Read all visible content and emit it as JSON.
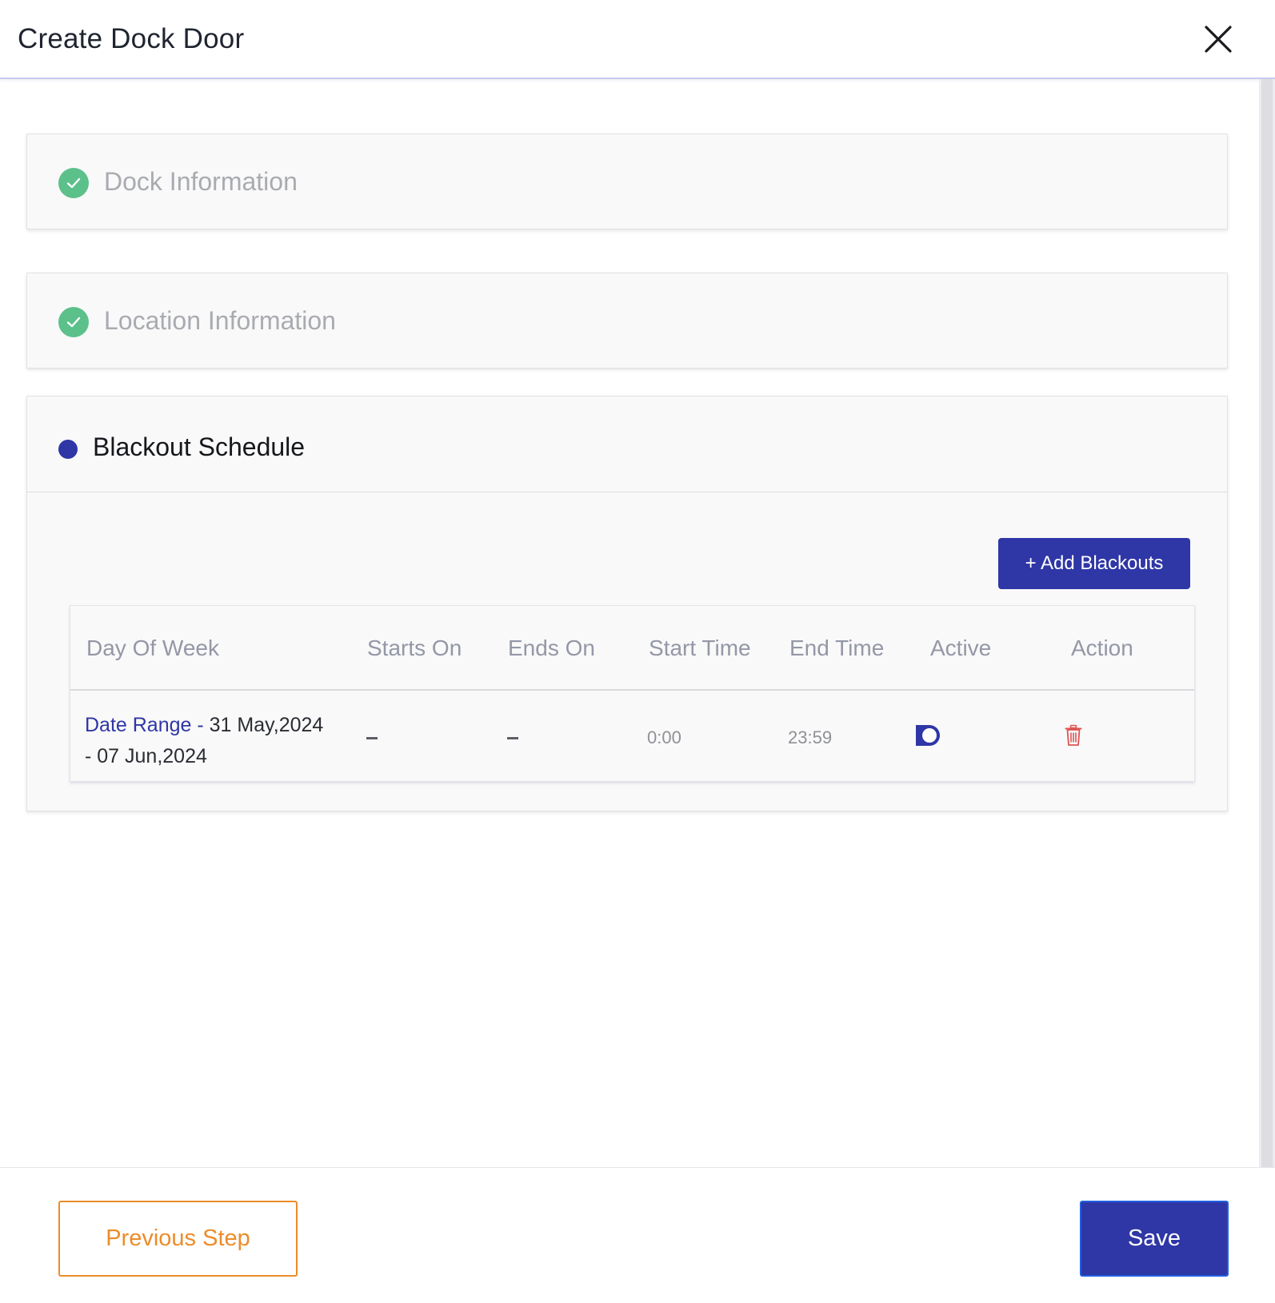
{
  "modal": {
    "title": "Create Dock Door"
  },
  "steps": {
    "dock": {
      "title": "Dock Information",
      "status": "complete"
    },
    "location": {
      "title": "Location Information",
      "status": "complete"
    },
    "blackout": {
      "title": "Blackout Schedule",
      "status": "active"
    }
  },
  "blackout_schedule": {
    "add_button_label": "+ Add Blackouts",
    "columns": [
      "Day Of Week",
      "Starts On",
      "Ends On",
      "Start Time",
      "End Time",
      "Active",
      "Action"
    ],
    "rows": [
      {
        "day_of_week_label": "Date Range - ",
        "day_of_week_line1": "31 May,2024",
        "day_of_week_line2": "- 07 Jun,2024",
        "starts_on": "–",
        "ends_on": "–",
        "start_time": "0:00",
        "end_time": "23:59",
        "active": true,
        "action_icon": "trash-icon"
      }
    ]
  },
  "footer": {
    "previous_label": "Previous Step",
    "save_label": "Save"
  },
  "colors": {
    "primary": "#2f36a6",
    "success": "#5cc08a",
    "accent_orange": "#ec8c2a",
    "danger": "#e05353",
    "muted_text": "#a9abb1"
  }
}
